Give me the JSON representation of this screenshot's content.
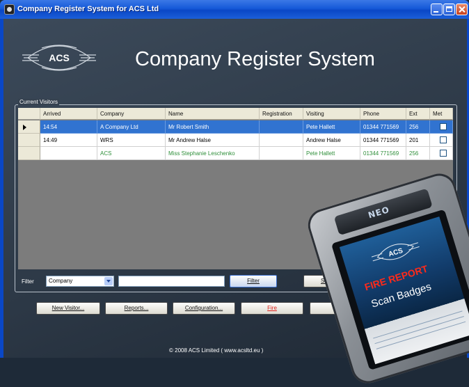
{
  "window": {
    "title": "Company Register System for ACS Ltd"
  },
  "header": {
    "title": "Company Register System",
    "logo_text": "ACS"
  },
  "group": {
    "legend": "Current Visitors"
  },
  "grid": {
    "columns": [
      "Arrived",
      "Company",
      "Name",
      "Registration",
      "Visiting",
      "Phone",
      "Ext",
      "Met"
    ],
    "rows": [
      {
        "arrived": "14:54",
        "company": "A Company Ltd",
        "name": "Mr Robert  Smith",
        "registration": "",
        "visiting": "Pete Hallett",
        "phone": "01344 771569",
        "ext": "256",
        "met": false
      },
      {
        "arrived": "14:49",
        "company": "WRS",
        "name": "Mr Andrew  Halse",
        "registration": "",
        "visiting": "Andrew Halse",
        "phone": "01344 771569",
        "ext": "201",
        "met": false
      },
      {
        "arrived": "",
        "company": "ACS",
        "name": "Miss Stephanie  Leschenko",
        "registration": "",
        "visiting": "Pete Hallett",
        "phone": "01344 771569",
        "ext": "256",
        "met": false
      }
    ]
  },
  "filter": {
    "label": "Filter",
    "selected": "Company",
    "value": "",
    "button": "Filter",
    "start_button_partial": "Sta"
  },
  "buttons": {
    "new_visitor": "New Visitor...",
    "reports": "Reports...",
    "configuration": "Configuration...",
    "fire": "Fire",
    "partial": "H"
  },
  "footer": "© 2008 ACS Limited ( www.acsltd.eu )",
  "device": {
    "brand": "NEO",
    "logo_text": "ACS",
    "fire_report": "FIRE REPORT",
    "scan_badges": "Scan Badges"
  },
  "colors": {
    "title_bar": "#1559d8",
    "selected_row": "#3173d0",
    "green_row_text": "#2f8f3a",
    "fire_text": "#e0201a"
  }
}
